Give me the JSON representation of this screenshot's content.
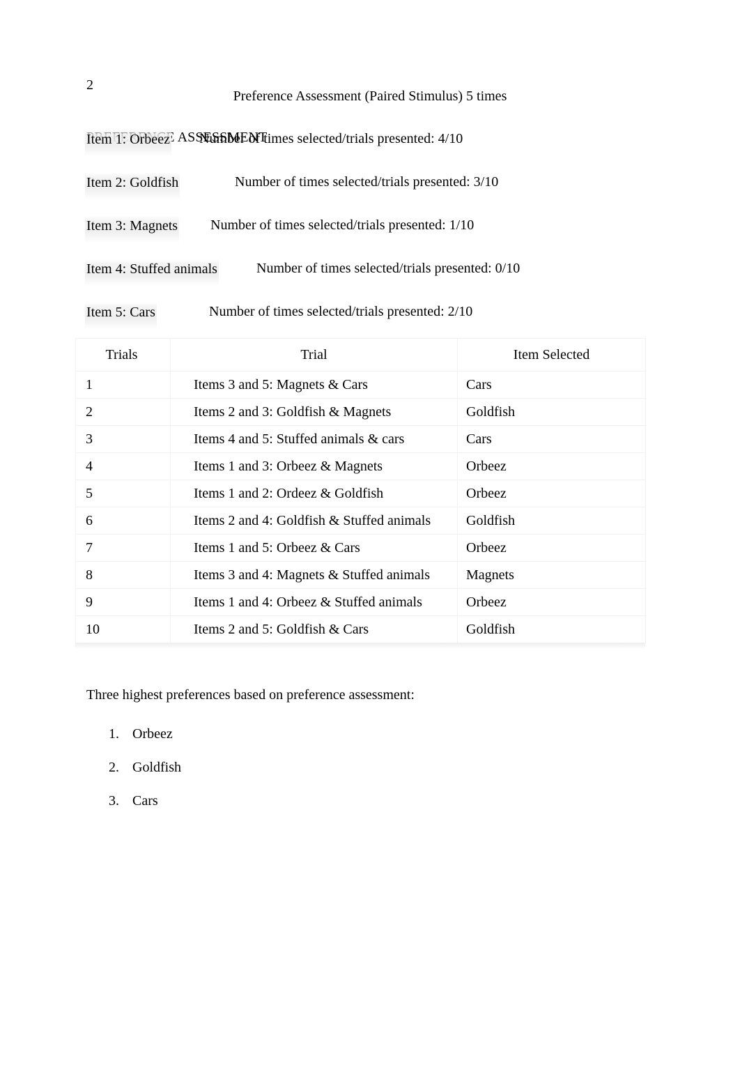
{
  "document": {
    "page_number": "2",
    "running_head": "PREFERENCE ASSESSMENT",
    "subtitle": "Preference Assessment (Paired Stimulus) 5 times",
    "background_color": "#ffffff",
    "text_color": "#000000",
    "highlight_color": "#efefef",
    "table_border_color": "#f1f1f1"
  },
  "items": [
    {
      "label": "Item 1: Orbeez",
      "stat": "Number of times selected/trials presented: 4/10",
      "name": "Orbeez",
      "selected": 4,
      "trials": 10
    },
    {
      "label": "Item 2: Goldfish",
      "stat": "Number of times selected/trials presented: 3/10",
      "name": "Goldfish",
      "selected": 3,
      "trials": 10
    },
    {
      "label": "Item 3: Magnets",
      "stat": "Number of times selected/trials presented: 1/10",
      "name": "Magnets",
      "selected": 1,
      "trials": 10
    },
    {
      "label": "Item 4: Stuffed animals",
      "stat": "Number of times selected/trials presented: 0/10",
      "name": "Stuffed animals",
      "selected": 0,
      "trials": 10
    },
    {
      "label": "Item 5: Cars",
      "stat": "Number of times selected/trials presented: 2/10",
      "name": "Cars",
      "selected": 2,
      "trials": 10
    }
  ],
  "table": {
    "headers": [
      "Trials",
      "Trial",
      "Item Selected"
    ],
    "rows": [
      {
        "trial_number": "1",
        "pairing": "Items 3 and 5: Magnets & Cars",
        "item_selected": "Cars"
      },
      {
        "trial_number": "2",
        "pairing": "Items 2 and 3: Goldfish & Magnets",
        "item_selected": "Goldfish"
      },
      {
        "trial_number": "3",
        "pairing": "Items 4 and 5: Stuffed animals & cars",
        "item_selected": "Cars"
      },
      {
        "trial_number": "4",
        "pairing": "Items 1 and 3: Orbeez & Magnets",
        "item_selected": "Orbeez"
      },
      {
        "trial_number": "5",
        "pairing": "Items 1 and 2: Ordeez & Goldfish",
        "item_selected": "Orbeez"
      },
      {
        "trial_number": "6",
        "pairing": "Items 2 and 4: Goldfish & Stuffed animals",
        "item_selected": "Goldfish"
      },
      {
        "trial_number": "7",
        "pairing": "Items 1 and 5: Orbeez & Cars",
        "item_selected": "Orbeez"
      },
      {
        "trial_number": "8",
        "pairing": "Items 3 and 4: Magnets & Stuffed animals",
        "item_selected": "Magnets"
      },
      {
        "trial_number": "9",
        "pairing": "Items 1 and 4: Orbeez & Stuffed animals",
        "item_selected": "Orbeez"
      },
      {
        "trial_number": "10",
        "pairing": "Items 2 and 5: Goldfish & Cars",
        "item_selected": "Goldfish"
      }
    ]
  },
  "summary": {
    "heading": "Three highest preferences based on preference assessment:",
    "ranked": [
      {
        "num": "1.",
        "label": "Orbeez"
      },
      {
        "num": "2.",
        "label": "Goldfish"
      },
      {
        "num": "3.",
        "label": "Cars"
      }
    ]
  }
}
